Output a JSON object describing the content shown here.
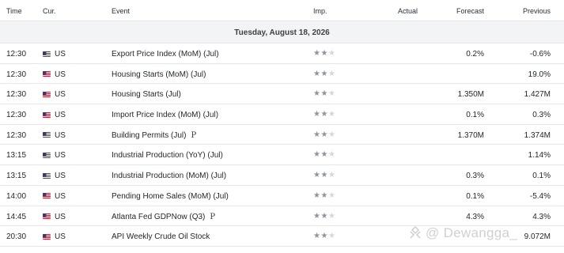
{
  "headers": {
    "time": "Time",
    "currency": "Cur.",
    "event": "Event",
    "importance": "Imp.",
    "actual": "Actual",
    "forecast": "Forecast",
    "previous": "Previous"
  },
  "date_label": "Tuesday, August 18, 2026",
  "rows": [
    {
      "time": "12:30",
      "currency": "US",
      "event": "Export Price Index (MoM) (Jul)",
      "p": "",
      "importance": 2,
      "actual": "",
      "forecast": "0.2%",
      "previous": "-0.6%"
    },
    {
      "time": "12:30",
      "currency": "US",
      "event": "Housing Starts (MoM) (Jul)",
      "p": "",
      "importance": 2,
      "actual": "",
      "forecast": "",
      "previous": "19.0%"
    },
    {
      "time": "12:30",
      "currency": "US",
      "event": "Housing Starts  (Jul)",
      "p": "",
      "importance": 2,
      "actual": "",
      "forecast": "1.350M",
      "previous": "1.427M"
    },
    {
      "time": "12:30",
      "currency": "US",
      "event": "Import Price Index (MoM) (Jul)",
      "p": "",
      "importance": 2,
      "actual": "",
      "forecast": "0.1%",
      "previous": "0.3%"
    },
    {
      "time": "12:30",
      "currency": "US",
      "event": "Building Permits  (Jul)",
      "p": "P",
      "importance": 2,
      "actual": "",
      "forecast": "1.370M",
      "previous": "1.374M"
    },
    {
      "time": "13:15",
      "currency": "US",
      "event": "Industrial Production (YoY) (Jul)",
      "p": "",
      "importance": 2,
      "actual": "",
      "forecast": "",
      "previous": "1.14%"
    },
    {
      "time": "13:15",
      "currency": "US",
      "event": "Industrial Production (MoM) (Jul)",
      "p": "",
      "importance": 2,
      "actual": "",
      "forecast": "0.3%",
      "previous": "0.1%"
    },
    {
      "time": "14:00",
      "currency": "US",
      "event": "Pending Home Sales (MoM) (Jul)",
      "p": "",
      "importance": 2,
      "actual": "",
      "forecast": "0.1%",
      "previous": "-5.4%"
    },
    {
      "time": "14:45",
      "currency": "US",
      "event": "Atlanta Fed GDPNow  (Q3)",
      "p": "P",
      "importance": 2,
      "actual": "",
      "forecast": "4.3%",
      "previous": "4.3%"
    },
    {
      "time": "20:30",
      "currency": "US",
      "event": "API Weekly Crude Oil Stock",
      "p": "",
      "importance": 2,
      "actual": "",
      "forecast": "",
      "previous": "9.072M"
    }
  ],
  "watermark": "@ Dewangga_",
  "colors": {
    "flag_red": "#b22234",
    "flag_blue": "#3c3b6e",
    "star_on": "#8e949c",
    "star_off": "#d3d6da",
    "divider": "#e3e6ea",
    "date_bg": "#f3f4f6"
  }
}
